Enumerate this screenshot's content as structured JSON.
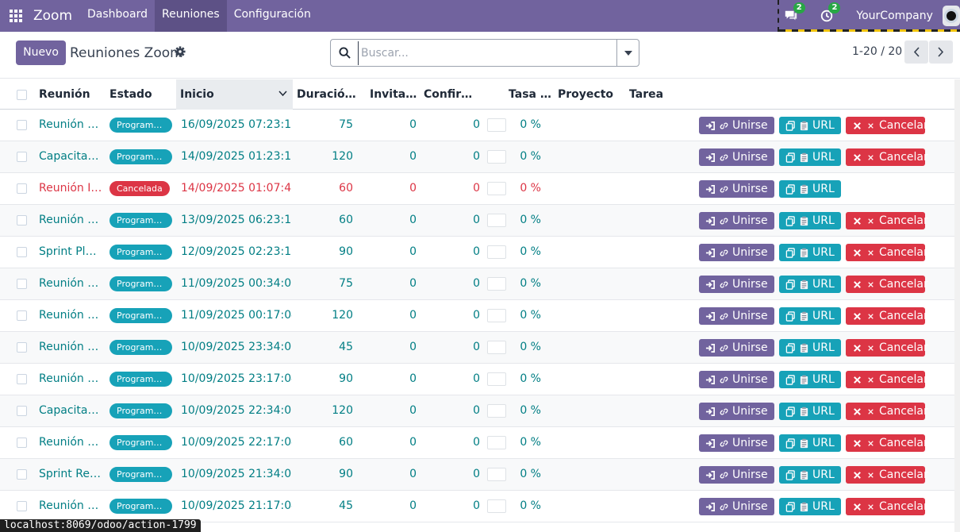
{
  "navbar": {
    "brand": "Zoom",
    "menu": [
      "Dashboard",
      "Reuniones",
      "Configuración"
    ],
    "active_menu": "Reuniones",
    "chat_count": "2",
    "activity_count": "2",
    "company": "YourCompany",
    "bg_color": "#71639e"
  },
  "control_panel": {
    "new_label": "Nuevo",
    "title": "Reuniones Zoom",
    "search_placeholder": "Buscar...",
    "pager": "1-20 / 20"
  },
  "table": {
    "columns": [
      "Reunión",
      "Estado",
      "Inicio",
      "Duració…",
      "Invitados",
      "Confirm…",
      "Tasa (%)",
      "Proyecto",
      "Tarea"
    ],
    "sorted_column": "Inicio",
    "rows": [
      {
        "name": "Reunión d…",
        "status": "Program…",
        "start": "16/09/2025 07:23:15",
        "duration": "75",
        "invited": "0",
        "confirmed": "0",
        "rate": "0 %",
        "cancelled": false
      },
      {
        "name": "Capacitaci…",
        "status": "Program…",
        "start": "14/09/2025 01:23:15",
        "duration": "120",
        "invited": "0",
        "confirmed": "0",
        "rate": "0 %",
        "cancelled": false
      },
      {
        "name": "Reunión I…",
        "status": "Cancelada",
        "start": "14/09/2025 01:07:49",
        "duration": "60",
        "invited": "0",
        "confirmed": "0",
        "rate": "0 %",
        "cancelled": true
      },
      {
        "name": "Reunión d…",
        "status": "Program…",
        "start": "13/09/2025 06:23:15",
        "duration": "60",
        "invited": "0",
        "confirmed": "0",
        "rate": "0 %",
        "cancelled": false
      },
      {
        "name": "Sprint Pla…",
        "status": "Program…",
        "start": "12/09/2025 02:23:15",
        "duration": "90",
        "invited": "0",
        "confirmed": "0",
        "rate": "0 %",
        "cancelled": false
      },
      {
        "name": "Reunión d…",
        "status": "Program…",
        "start": "11/09/2025 00:34:08",
        "duration": "75",
        "invited": "0",
        "confirmed": "0",
        "rate": "0 %",
        "cancelled": false
      },
      {
        "name": "Reunión d…",
        "status": "Program…",
        "start": "11/09/2025 00:17:04",
        "duration": "120",
        "invited": "0",
        "confirmed": "0",
        "rate": "0 %",
        "cancelled": false
      },
      {
        "name": "Reunión d…",
        "status": "Program…",
        "start": "10/09/2025 23:34:08",
        "duration": "45",
        "invited": "0",
        "confirmed": "0",
        "rate": "0 %",
        "cancelled": false
      },
      {
        "name": "Reunión d…",
        "status": "Program…",
        "start": "10/09/2025 23:17:04",
        "duration": "90",
        "invited": "0",
        "confirmed": "0",
        "rate": "0 %",
        "cancelled": false
      },
      {
        "name": "Capacitaci…",
        "status": "Program…",
        "start": "10/09/2025 22:34:08",
        "duration": "120",
        "invited": "0",
        "confirmed": "0",
        "rate": "0 %",
        "cancelled": false
      },
      {
        "name": "Reunión d…",
        "status": "Program…",
        "start": "10/09/2025 22:17:04",
        "duration": "60",
        "invited": "0",
        "confirmed": "0",
        "rate": "0 %",
        "cancelled": false
      },
      {
        "name": "Sprint Rev…",
        "status": "Program…",
        "start": "10/09/2025 21:34:08",
        "duration": "90",
        "invited": "0",
        "confirmed": "0",
        "rate": "0 %",
        "cancelled": false
      },
      {
        "name": "Reunión d…",
        "status": "Program…",
        "start": "10/09/2025 21:17:04",
        "duration": "45",
        "invited": "0",
        "confirmed": "0",
        "rate": "0 %",
        "cancelled": false
      }
    ]
  },
  "actions": {
    "join": "Unirse",
    "url": "URL",
    "cancel": "Cancelar"
  },
  "status_url": "localhost:8069/odoo/action-1799"
}
